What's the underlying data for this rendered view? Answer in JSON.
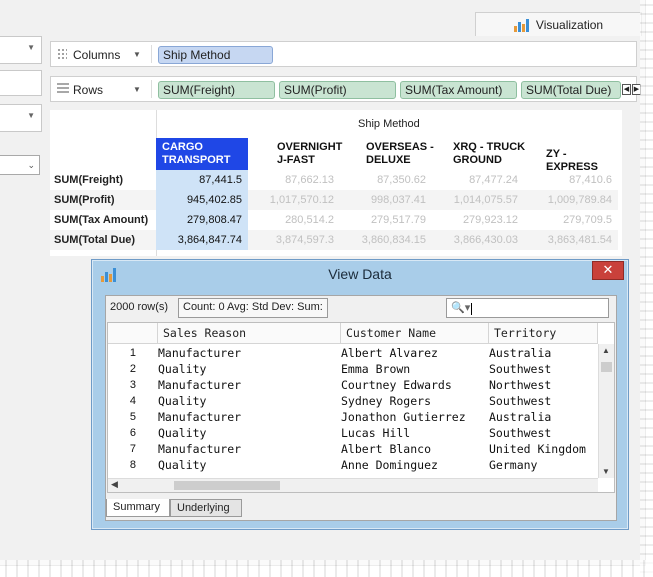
{
  "top_tab": {
    "label": "Visualization"
  },
  "shelves": {
    "columns": {
      "label": "Columns",
      "pills": [
        "Ship Method"
      ]
    },
    "rows": {
      "label": "Rows",
      "pills": [
        "SUM(Freight)",
        "SUM(Profit)",
        "SUM(Tax Amount)",
        "SUM(Total Due)"
      ]
    }
  },
  "crosstab": {
    "header": "Ship Method",
    "columns": [
      "CARGO TRANSPORT",
      "OVERNIGHT J-FAST",
      "OVERSEAS - DELUXE",
      "XRQ - TRUCK GROUND",
      "ZY - EXPRESS"
    ],
    "rows": [
      {
        "label": "SUM(Freight)",
        "values": [
          "87,441.5",
          "87,662.13",
          "87,350.62",
          "87,477.24",
          "87,410.6"
        ]
      },
      {
        "label": "SUM(Profit)",
        "values": [
          "945,402.85",
          "1,017,570.12",
          "998,037.41",
          "1,014,075.57",
          "1,009,789.84"
        ]
      },
      {
        "label": "SUM(Tax Amount)",
        "values": [
          "279,808.47",
          "280,514.2",
          "279,517.79",
          "279,923.12",
          "279,709.5"
        ]
      },
      {
        "label": "SUM(Total Due)",
        "values": [
          "3,864,847.74",
          "3,874,597.3",
          "3,860,834.15",
          "3,866,430.03",
          "3,863,481.54"
        ]
      }
    ]
  },
  "dialog": {
    "title": "View Data",
    "close_glyph": "✕",
    "row_count": "2000 row(s)",
    "stats": "Count: 0  Avg:  Std Dev:  Sum:",
    "search_icon": "🔍▾",
    "grid": {
      "headers": [
        "Sales Reason",
        "Customer Name",
        "Territory"
      ],
      "rows": [
        {
          "n": "1",
          "reason": "Manufacturer",
          "customer": "Albert Alvarez",
          "territory": "Australia"
        },
        {
          "n": "2",
          "reason": "Quality",
          "customer": "Emma Brown",
          "territory": "Southwest"
        },
        {
          "n": "3",
          "reason": "Manufacturer",
          "customer": "Courtney Edwards",
          "territory": "Northwest"
        },
        {
          "n": "4",
          "reason": "Quality",
          "customer": "Sydney Rogers",
          "territory": "Southwest"
        },
        {
          "n": "5",
          "reason": "Manufacturer",
          "customer": "Jonathon Gutierrez",
          "territory": "Australia"
        },
        {
          "n": "6",
          "reason": "Quality",
          "customer": "Lucas Hill",
          "territory": "Southwest"
        },
        {
          "n": "7",
          "reason": "Manufacturer",
          "customer": "Albert Blanco",
          "territory": "United Kingdom"
        },
        {
          "n": "8",
          "reason": "Quality",
          "customer": "Anne Dominguez",
          "territory": "Germany"
        }
      ]
    },
    "tabs": [
      "Summary",
      "Underlying"
    ]
  },
  "colors": {
    "selected_header": "#1f47e6",
    "selected_cell": "#cfe3f7",
    "dimension_pill": "#c6d7f2",
    "measure_pill": "#c9e4d2",
    "dialog_frame": "#a9cde9",
    "close_button": "#c9413b"
  }
}
